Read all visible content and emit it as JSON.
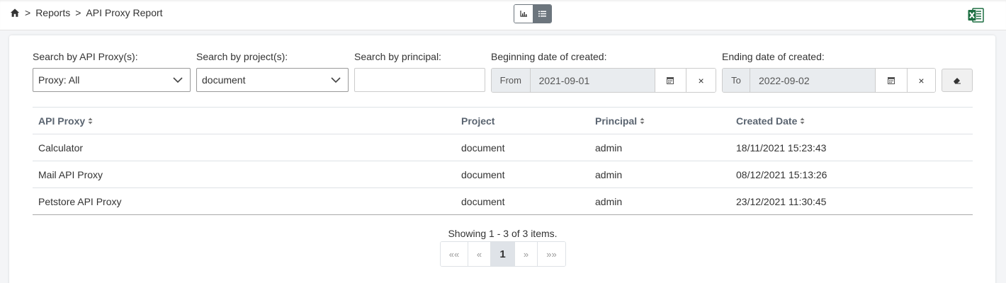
{
  "breadcrumb": {
    "home_icon": "home-icon",
    "separator": ">",
    "items": [
      "Reports",
      "API Proxy Report"
    ]
  },
  "view_toggle": {
    "options": [
      {
        "icon": "bar-chart-icon",
        "active": false
      },
      {
        "icon": "list-icon",
        "active": true
      }
    ],
    "active_color": "#6c757d"
  },
  "export": {
    "icon": "excel-icon",
    "color": "#1d6f42"
  },
  "filters": {
    "api_proxy": {
      "label": "Search by API Proxy(s):",
      "value": "Proxy: All"
    },
    "project": {
      "label": "Search by project(s):",
      "value": "document"
    },
    "principal": {
      "label": "Search by principal:",
      "value": "",
      "placeholder": ""
    },
    "begin_date": {
      "label": "Beginning date of created:",
      "prefix": "From",
      "value": "2021-09-01"
    },
    "end_date": {
      "label": "Ending date of created:",
      "prefix": "To",
      "value": "2022-09-02"
    },
    "clear_icon": "eraser-icon",
    "calendar_icon": "calendar-icon",
    "close_glyph": "×"
  },
  "table": {
    "columns": [
      {
        "label": "API Proxy",
        "sortable": true
      },
      {
        "label": "Project",
        "sortable": false
      },
      {
        "label": "Principal",
        "sortable": true
      },
      {
        "label": "Created Date",
        "sortable": true
      }
    ],
    "rows": [
      [
        "Calculator",
        "document",
        "admin",
        "18/11/2021 15:23:43"
      ],
      [
        "Mail API Proxy",
        "document",
        "admin",
        "08/12/2021 15:13:26"
      ],
      [
        "Petstore API Proxy",
        "document",
        "admin",
        "23/12/2021 11:30:45"
      ]
    ]
  },
  "pagination": {
    "summary": "Showing 1 - 3 of 3 items.",
    "first": "««",
    "prev": "«",
    "current": "1",
    "next": "»",
    "last": "»»"
  }
}
